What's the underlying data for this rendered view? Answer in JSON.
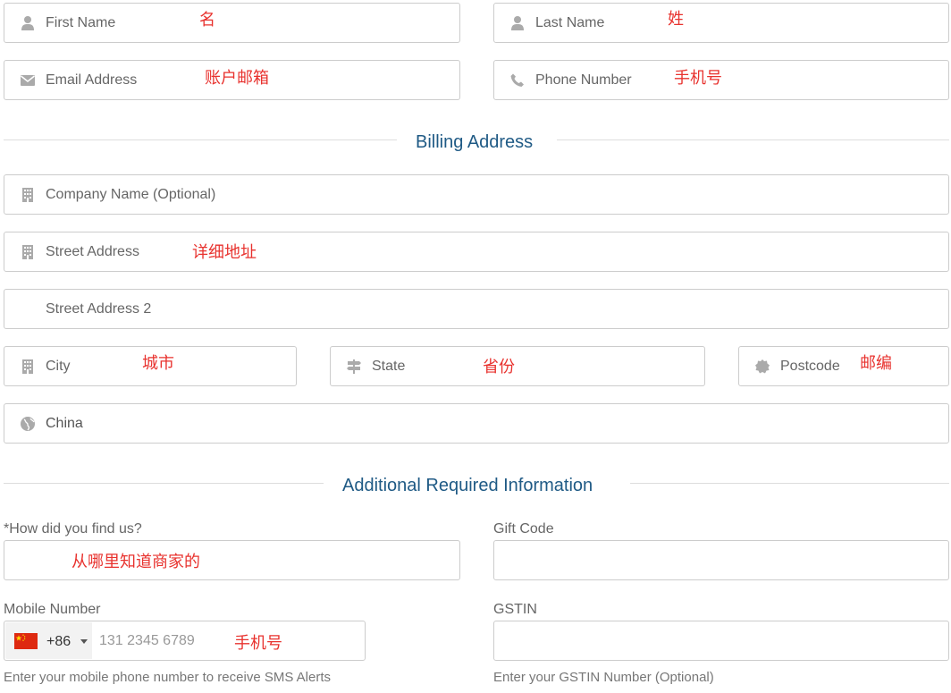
{
  "contact": {
    "first_name": {
      "placeholder": "First Name",
      "note": "名",
      "icon": "user-icon"
    },
    "last_name": {
      "placeholder": "Last Name",
      "note": "姓",
      "icon": "user-icon"
    },
    "email": {
      "placeholder": "Email Address",
      "note": "账户邮箱",
      "icon": "envelope-icon"
    },
    "phone": {
      "placeholder": "Phone Number",
      "note": "手机号",
      "icon": "phone-icon"
    }
  },
  "billing": {
    "title": "Billing Address",
    "company": {
      "placeholder": "Company Name (Optional)",
      "icon": "building-icon"
    },
    "street": {
      "placeholder": "Street Address",
      "note": "详细地址",
      "icon": "building-icon"
    },
    "street2": {
      "placeholder": "Street Address 2"
    },
    "city": {
      "placeholder": "City",
      "note": "城市",
      "icon": "building-icon"
    },
    "state": {
      "placeholder": "State",
      "note": "省份",
      "icon": "signpost-icon"
    },
    "postcode": {
      "placeholder": "Postcode",
      "note": "邮编",
      "icon": "badge-icon"
    },
    "country": {
      "value": "China",
      "icon": "globe-icon"
    }
  },
  "additional": {
    "title": "Additional Required Information",
    "how_found": {
      "label": "*How did you find us?",
      "note": "从哪里知道商家的"
    },
    "gift_code": {
      "label": "Gift Code"
    },
    "mobile": {
      "label": "Mobile Number",
      "dial_code": "+86",
      "placeholder": "131 2345 6789",
      "note": "手机号",
      "help": "Enter your mobile phone number to receive SMS Alerts",
      "flag_icon": "china-flag-icon"
    },
    "gstin": {
      "label": "GSTIN",
      "help": "Enter your GSTIN Number (Optional)"
    }
  },
  "colors": {
    "section_title": "#1f5a85",
    "annotation": "#e8322e",
    "border": "#cccccc",
    "icon": "#aaaaaa"
  }
}
